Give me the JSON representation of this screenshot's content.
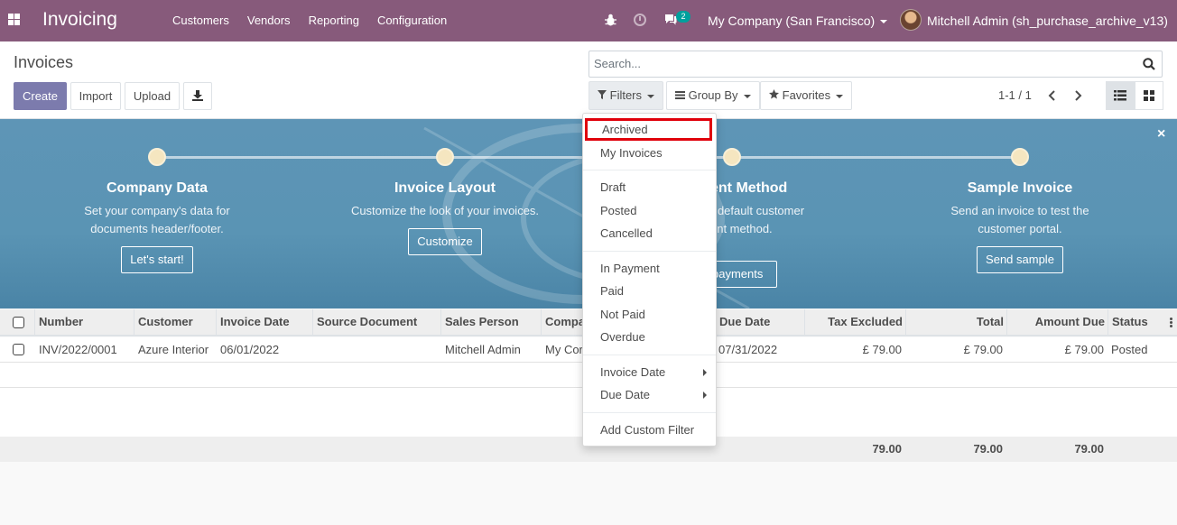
{
  "navbar": {
    "brand": "Invoicing",
    "menu": [
      "Customers",
      "Vendors",
      "Reporting",
      "Configuration"
    ],
    "chat_count": "2",
    "company": "My Company (San Francisco)",
    "user": "Mitchell Admin (sh_purchase_archive_v13)",
    "color": "#875a7b"
  },
  "control_panel": {
    "title": "Invoices",
    "buttons": {
      "create": "Create",
      "import": "Import",
      "upload": "Upload"
    },
    "search_placeholder": "Search...",
    "filters_label": "Filters",
    "groupby_label": "Group By",
    "favorites_label": "Favorites",
    "pager": "1-1 / 1"
  },
  "banner": {
    "steps": [
      {
        "title": "Company Data",
        "desc": "Set your company's data for documents header/footer.",
        "button": "Let's start!"
      },
      {
        "title": "Invoice Layout",
        "desc": "Customize the look of your invoices.",
        "button": "Customize"
      },
      {
        "title": "ent Method",
        "desc_line1": "r default customer",
        "desc_line2": "ent method.",
        "button": "payments"
      },
      {
        "title": "Sample Invoice",
        "desc": "Send an invoice to test the customer portal.",
        "button": "Send sample"
      }
    ],
    "close": "×"
  },
  "table": {
    "columns": [
      "Number",
      "Customer",
      "Invoice Date",
      "Source Document",
      "Sales Person",
      "Compa",
      "Due Date",
      "Tax Excluded",
      "Total",
      "Amount Due",
      "Status"
    ],
    "rows": [
      {
        "number": "INV/2022/0001",
        "customer": "Azure Interior",
        "invoice_date": "06/01/2022",
        "source": "",
        "salesperson": "Mitchell Admin",
        "company": "My Cor",
        "due_date": "07/31/2022",
        "tax_excluded": "£ 79.00",
        "total": "£ 79.00",
        "amount_due": "£ 79.00",
        "status": "Posted"
      }
    ],
    "totals": {
      "tax_excluded": "79.00",
      "total": "79.00",
      "amount_due": "79.00"
    }
  },
  "filters_dropdown": {
    "group1": [
      "Archived",
      "My Invoices"
    ],
    "group2": [
      "Draft",
      "Posted",
      "Cancelled"
    ],
    "group3": [
      "In Payment",
      "Paid",
      "Not Paid",
      "Overdue"
    ],
    "group4": [
      "Invoice Date",
      "Due Date"
    ],
    "group5": [
      "Add Custom Filter"
    ],
    "highlight_color": "#e0000b"
  }
}
